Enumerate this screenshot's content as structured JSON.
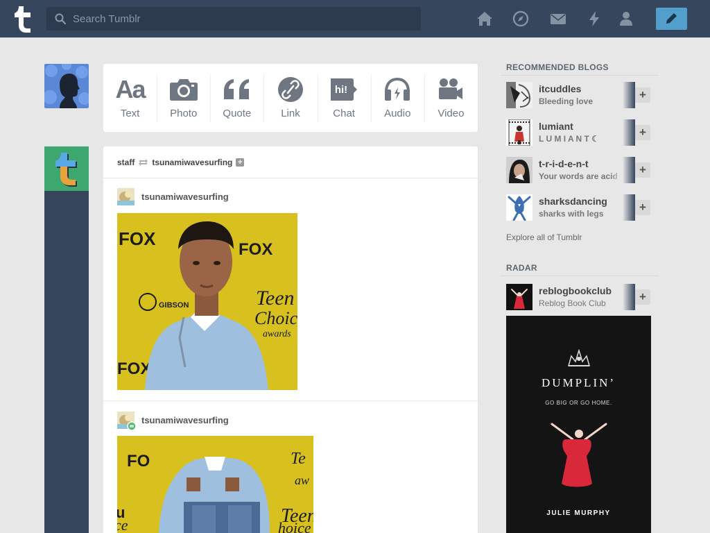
{
  "search": {
    "placeholder": "Search Tumblr"
  },
  "nav": {
    "icons": [
      "home-icon",
      "explore-icon",
      "inbox-icon",
      "activity-icon",
      "account-icon"
    ],
    "compose_icon": "pencil-icon"
  },
  "colors": {
    "header": "#36465d",
    "background": "#e7e7e7",
    "compose": "#529ecc",
    "staff_avatar": "#3ea66f"
  },
  "post_types": [
    {
      "label": "Text",
      "icon": "text-icon"
    },
    {
      "label": "Photo",
      "icon": "camera-icon"
    },
    {
      "label": "Quote",
      "icon": "quote-icon"
    },
    {
      "label": "Link",
      "icon": "link-icon"
    },
    {
      "label": "Chat",
      "icon": "chat-icon",
      "glyph": "hi!"
    },
    {
      "label": "Audio",
      "icon": "headphones-icon"
    },
    {
      "label": "Video",
      "icon": "video-camera-icon"
    }
  ],
  "post": {
    "author": "staff",
    "reblogged_from": "tsunamiwavesurfing",
    "trail": [
      {
        "username": "tsunamiwavesurfing"
      },
      {
        "username": "tsunamiwavesurfing"
      }
    ]
  },
  "sidebar": {
    "recommended_title": "RECOMMENDED BLOGS",
    "recommended": [
      {
        "name": "itcuddles",
        "desc": "Bleeding love"
      },
      {
        "name": "lumiant",
        "desc": "L U M I A N T ☾"
      },
      {
        "name": "t-r-i-d-e-n-t",
        "desc": "Your words are acid"
      },
      {
        "name": "sharksdancing",
        "desc": "sharks with legs"
      }
    ],
    "explore_link": "Explore all of Tumblr",
    "radar_title": "RADAR",
    "radar": {
      "name": "reblogbookclub",
      "desc": "Reblog Book Club"
    },
    "book": {
      "title": "DUMPLIN’",
      "tagline": "GO BIG OR GO HOME.",
      "author": "JULIE MURPHY"
    }
  }
}
